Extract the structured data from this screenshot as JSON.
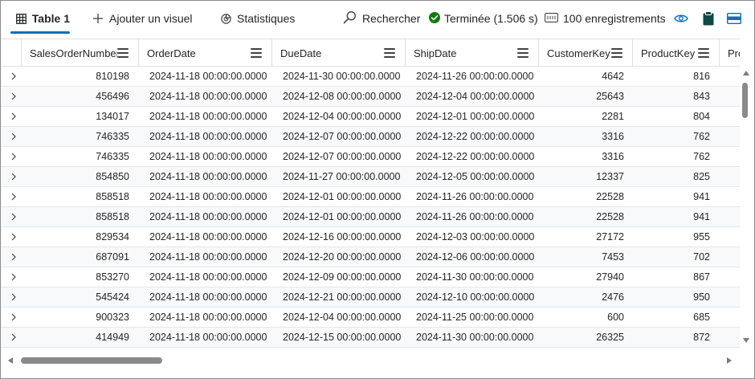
{
  "toolbar": {
    "tabs": [
      {
        "label": "Table 1",
        "icon": "table-icon",
        "selected": true
      },
      {
        "label": "Ajouter un visuel",
        "icon": "plus-icon",
        "selected": false
      },
      {
        "label": "Statistiques",
        "icon": "stats-icon",
        "selected": false
      }
    ],
    "search_label": "Rechercher",
    "status_label": "Terminée (1.506 s)",
    "records_label": "100 enregistrements",
    "accent_color": "#0f6cbd",
    "success_color": "#107c10"
  },
  "grid": {
    "columns": [
      "SalesOrderNumber",
      "OrderDate",
      "DueDate",
      "ShipDate",
      "CustomerKey",
      "ProductKey",
      "Prom"
    ],
    "rows": [
      [
        "810198",
        "2024-11-18 00:00:00.0000",
        "2024-11-30 00:00:00.0000",
        "2024-11-26 00:00:00.0000",
        "4642",
        "816"
      ],
      [
        "456496",
        "2024-11-18 00:00:00.0000",
        "2024-12-08 00:00:00.0000",
        "2024-12-04 00:00:00.0000",
        "25643",
        "843"
      ],
      [
        "134017",
        "2024-11-18 00:00:00.0000",
        "2024-12-04 00:00:00.0000",
        "2024-12-01 00:00:00.0000",
        "2281",
        "804"
      ],
      [
        "746335",
        "2024-11-18 00:00:00.0000",
        "2024-12-07 00:00:00.0000",
        "2024-12-22 00:00:00.0000",
        "3316",
        "762"
      ],
      [
        "746335",
        "2024-11-18 00:00:00.0000",
        "2024-12-07 00:00:00.0000",
        "2024-12-22 00:00:00.0000",
        "3316",
        "762"
      ],
      [
        "854850",
        "2024-11-18 00:00:00.0000",
        "2024-11-27 00:00:00.0000",
        "2024-12-05 00:00:00.0000",
        "12337",
        "825"
      ],
      [
        "858518",
        "2024-11-18 00:00:00.0000",
        "2024-12-01 00:00:00.0000",
        "2024-11-26 00:00:00.0000",
        "22528",
        "941"
      ],
      [
        "858518",
        "2024-11-18 00:00:00.0000",
        "2024-12-01 00:00:00.0000",
        "2024-11-26 00:00:00.0000",
        "22528",
        "941"
      ],
      [
        "829534",
        "2024-11-18 00:00:00.0000",
        "2024-12-16 00:00:00.0000",
        "2024-12-03 00:00:00.0000",
        "27172",
        "955"
      ],
      [
        "687091",
        "2024-11-18 00:00:00.0000",
        "2024-12-20 00:00:00.0000",
        "2024-12-06 00:00:00.0000",
        "7453",
        "702"
      ],
      [
        "853270",
        "2024-11-18 00:00:00.0000",
        "2024-12-09 00:00:00.0000",
        "2024-11-30 00:00:00.0000",
        "27940",
        "867"
      ],
      [
        "545424",
        "2024-11-18 00:00:00.0000",
        "2024-12-21 00:00:00.0000",
        "2024-12-10 00:00:00.0000",
        "2476",
        "950"
      ],
      [
        "900323",
        "2024-11-18 00:00:00.0000",
        "2024-12-04 00:00:00.0000",
        "2024-11-25 00:00:00.0000",
        "600",
        "685"
      ],
      [
        "414949",
        "2024-11-18 00:00:00.0000",
        "2024-12-15 00:00:00.0000",
        "2024-11-30 00:00:00.0000",
        "26325",
        "872"
      ]
    ]
  }
}
